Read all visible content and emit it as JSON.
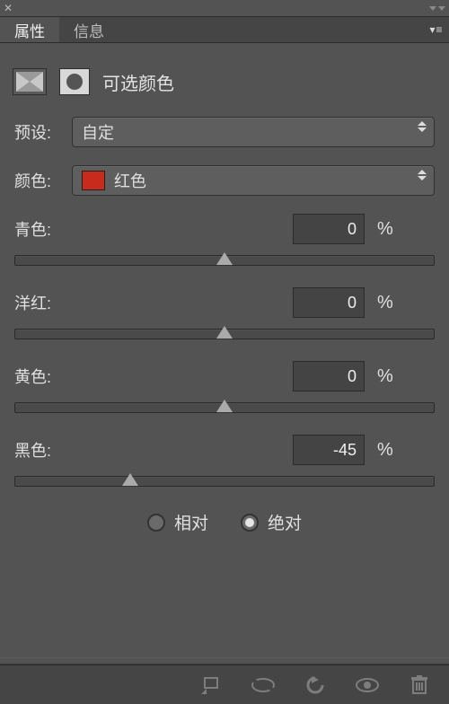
{
  "tabs": {
    "properties": "属性",
    "info": "信息"
  },
  "adjustment": {
    "title": "可选颜色"
  },
  "preset": {
    "label": "预设:",
    "value": "自定"
  },
  "color": {
    "label": "颜色:",
    "value": "红色",
    "swatch": "#c82a1c"
  },
  "sliders": {
    "cyan": {
      "label": "青色:",
      "value": "0",
      "pos": 50
    },
    "magenta": {
      "label": "洋红:",
      "value": "0",
      "pos": 50
    },
    "yellow": {
      "label": "黄色:",
      "value": "0",
      "pos": 50
    },
    "black": {
      "label": "黑色:",
      "value": "-45",
      "pos": 27.5
    }
  },
  "percent": "%",
  "method": {
    "relative": "相对",
    "absolute": "绝对",
    "selected": "absolute"
  }
}
